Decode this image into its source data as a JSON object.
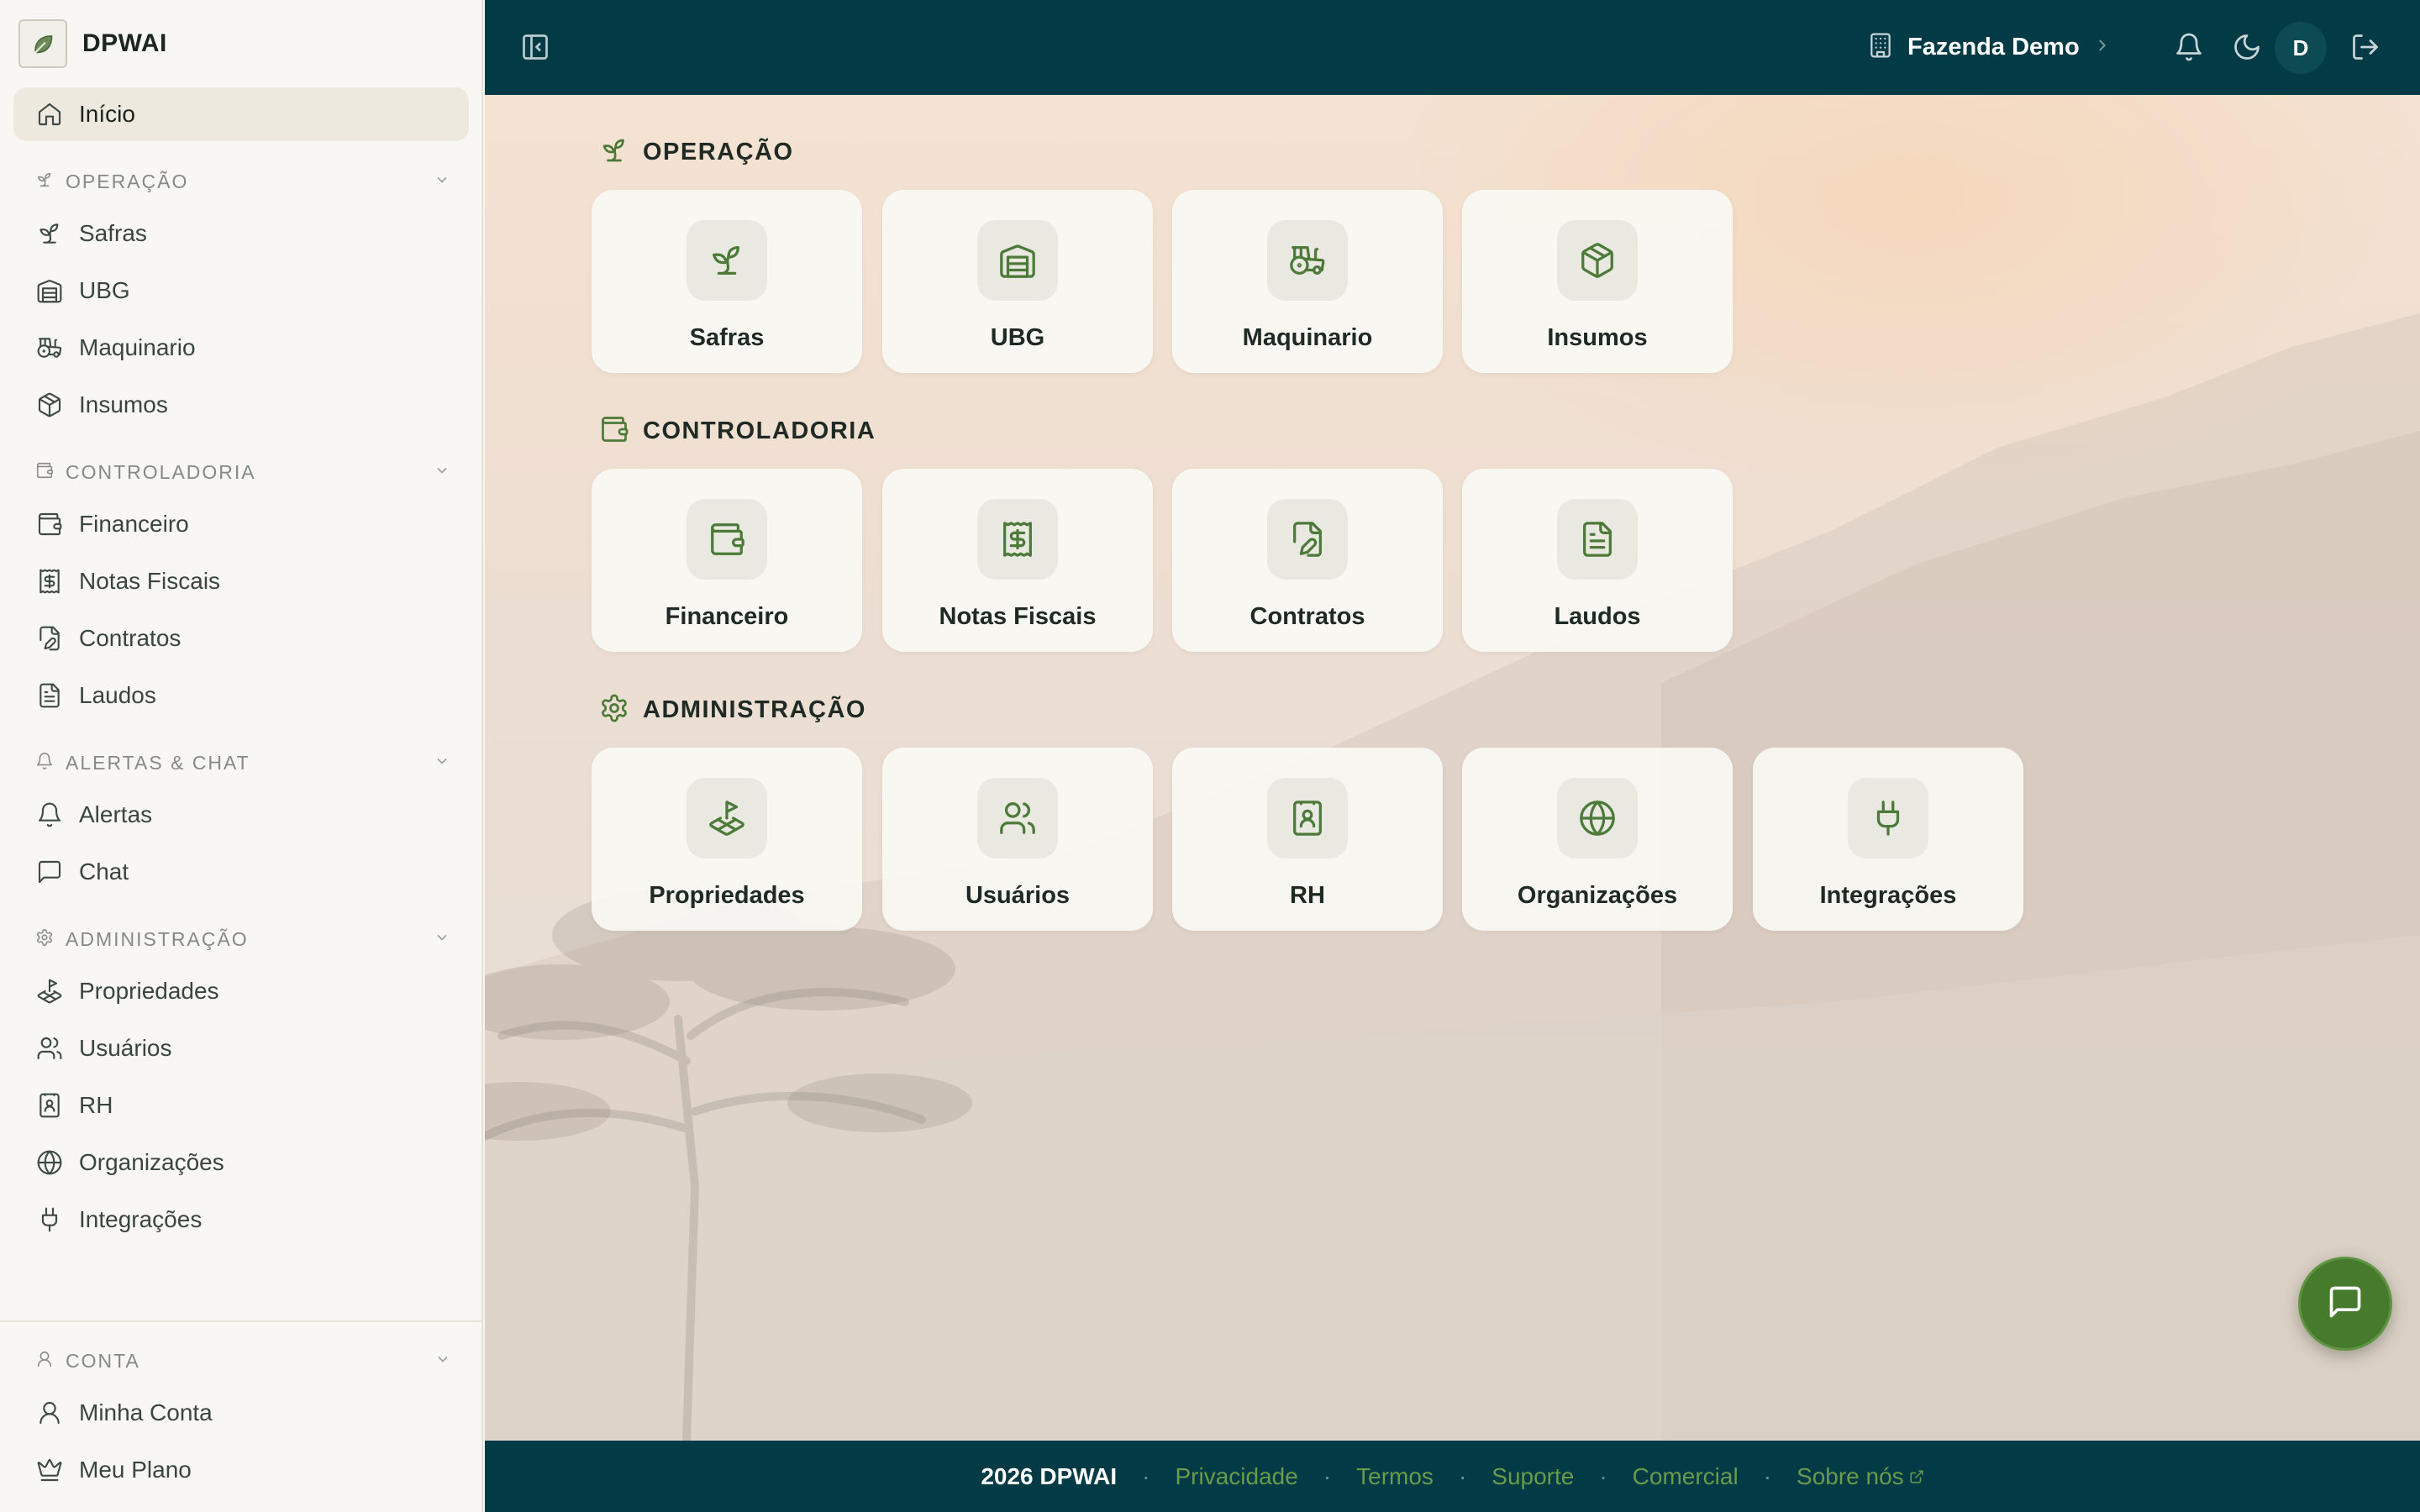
{
  "brand": {
    "name": "DPWAI"
  },
  "sidebar": {
    "home": {
      "label": "Início",
      "icon": "home-icon"
    },
    "sections": [
      {
        "title": "OPERAÇÃO",
        "icon": "sprout-icon",
        "items": [
          {
            "label": "Safras",
            "icon": "sprout-icon"
          },
          {
            "label": "UBG",
            "icon": "warehouse-icon"
          },
          {
            "label": "Maquinario",
            "icon": "tractor-icon"
          },
          {
            "label": "Insumos",
            "icon": "package-icon"
          }
        ]
      },
      {
        "title": "CONTROLADORIA",
        "icon": "wallet-icon",
        "items": [
          {
            "label": "Financeiro",
            "icon": "wallet-icon"
          },
          {
            "label": "Notas Fiscais",
            "icon": "receipt-icon"
          },
          {
            "label": "Contratos",
            "icon": "file-pen-icon"
          },
          {
            "label": "Laudos",
            "icon": "file-text-icon"
          }
        ]
      },
      {
        "title": "ALERTAS & CHAT",
        "icon": "bell-icon",
        "items": [
          {
            "label": "Alertas",
            "icon": "bell-icon"
          },
          {
            "label": "Chat",
            "icon": "message-square-icon"
          }
        ]
      },
      {
        "title": "ADMINISTRAÇÃO",
        "icon": "gear-icon",
        "items": [
          {
            "label": "Propriedades",
            "icon": "land-plot-icon"
          },
          {
            "label": "Usuários",
            "icon": "users-icon"
          },
          {
            "label": "RH",
            "icon": "contact-book-icon"
          },
          {
            "label": "Organizações",
            "icon": "globe-icon"
          },
          {
            "label": "Integrações",
            "icon": "plug-icon"
          }
        ]
      }
    ],
    "account": {
      "title": "CONTA",
      "icon": "user-icon",
      "items": [
        {
          "label": "Minha Conta",
          "icon": "user-icon"
        },
        {
          "label": "Meu Plano",
          "icon": "crown-icon"
        }
      ]
    }
  },
  "topbar": {
    "farm_name": "Fazenda Demo",
    "avatar_initial": "D"
  },
  "main": {
    "groups": [
      {
        "title": "OPERAÇÃO",
        "icon": "sprout-icon",
        "cards": [
          {
            "label": "Safras",
            "icon": "sprout-icon"
          },
          {
            "label": "UBG",
            "icon": "warehouse-icon"
          },
          {
            "label": "Maquinario",
            "icon": "tractor-icon"
          },
          {
            "label": "Insumos",
            "icon": "package-icon"
          }
        ]
      },
      {
        "title": "CONTROLADORIA",
        "icon": "wallet-icon",
        "cards": [
          {
            "label": "Financeiro",
            "icon": "wallet-icon"
          },
          {
            "label": "Notas Fiscais",
            "icon": "receipt-icon"
          },
          {
            "label": "Contratos",
            "icon": "file-pen-icon"
          },
          {
            "label": "Laudos",
            "icon": "file-text-icon"
          }
        ]
      },
      {
        "title": "ADMINISTRAÇÃO",
        "icon": "gear-icon",
        "cards": [
          {
            "label": "Propriedades",
            "icon": "land-plot-icon"
          },
          {
            "label": "Usuários",
            "icon": "users-icon"
          },
          {
            "label": "RH",
            "icon": "contact-book-icon"
          },
          {
            "label": "Organizações",
            "icon": "globe-icon"
          },
          {
            "label": "Integrações",
            "icon": "plug-icon"
          }
        ]
      }
    ]
  },
  "footer": {
    "copyright": "2026 DPWAI",
    "links": [
      "Privacidade",
      "Termos",
      "Suporte",
      "Comercial",
      "Sobre nós"
    ]
  },
  "colors": {
    "topbar": "#023b46",
    "accent_green": "#467a2c",
    "link_green": "#6a9a4a",
    "sidebar_bg": "#f9f7f3"
  }
}
